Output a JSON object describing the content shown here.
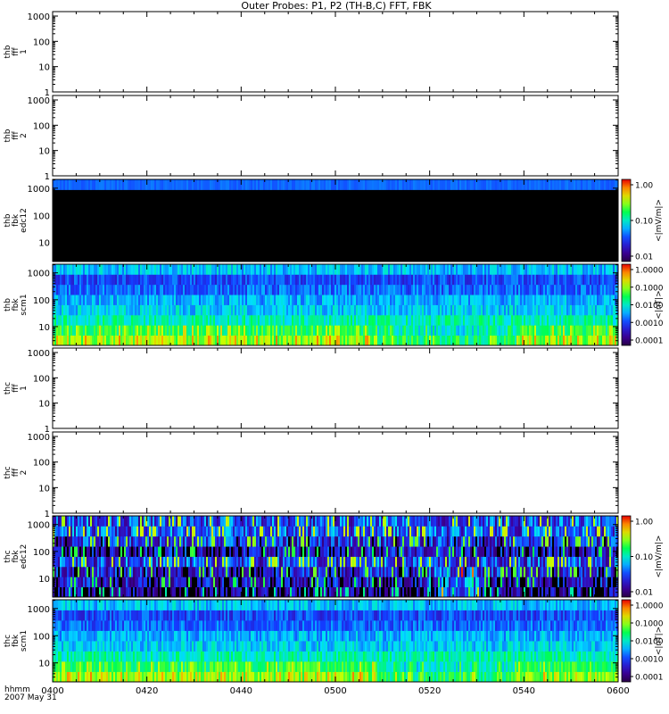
{
  "title": "Outer Probes: P1, P2 (TH-B,C) FFT, FBK",
  "chart_data": {
    "type": "heatmap",
    "title": "Outer Probes: P1, P2 (TH-B,C) FFT, FBK",
    "x_axis": {
      "ticks": [
        "0400",
        "0420",
        "0440",
        "0500",
        "0520",
        "0540",
        "0600"
      ],
      "label_line1": "hhmm",
      "label_line2": "2007 May 31"
    },
    "panels": [
      {
        "id": "thb-fff-1",
        "ylabel": [
          "thb",
          "fff",
          "1"
        ],
        "yticks": [
          "1000",
          "100",
          "10",
          "1"
        ],
        "has_data": false
      },
      {
        "id": "thb-fff-2",
        "ylabel": [
          "thb",
          "fff",
          "2"
        ],
        "yticks": [
          "1000",
          "100",
          "10",
          "1"
        ],
        "has_data": false
      },
      {
        "id": "thb-fbk-edc12",
        "ylabel": [
          "thb",
          "fbk",
          "edc12"
        ],
        "yticks": [
          "1000",
          "100",
          "10"
        ],
        "has_data": true,
        "pattern": "thb-edc",
        "colorbar": {
          "label": "<|mV/m|>",
          "ticks": [
            "1.00",
            "0.10",
            "0.01"
          ]
        }
      },
      {
        "id": "thb-fbk-scm1",
        "ylabel": [
          "thb",
          "fbk",
          "scm1"
        ],
        "yticks": [
          "1000",
          "100",
          "10"
        ],
        "has_data": true,
        "pattern": "scm",
        "colorbar": {
          "label": "<|nT|>",
          "ticks": [
            "1.0000",
            "0.1000",
            "0.0100",
            "0.0010",
            "0.0001"
          ]
        }
      },
      {
        "id": "thc-fff-1",
        "ylabel": [
          "thc",
          "fff",
          "1"
        ],
        "yticks": [
          "1000",
          "100",
          "10",
          "1"
        ],
        "has_data": false
      },
      {
        "id": "thc-fff-2",
        "ylabel": [
          "thc",
          "fff",
          "2"
        ],
        "yticks": [
          "1000",
          "100",
          "10",
          "1"
        ],
        "has_data": false
      },
      {
        "id": "thc-fbk-edc12",
        "ylabel": [
          "thc",
          "fbk",
          "edc12"
        ],
        "yticks": [
          "1000",
          "100",
          "10"
        ],
        "has_data": true,
        "pattern": "thc-edc",
        "colorbar": {
          "label": "<|mV/m|>",
          "ticks": [
            "1.00",
            "0.10",
            "0.01"
          ]
        }
      },
      {
        "id": "thc-fbk-scm1",
        "ylabel": [
          "thc",
          "fbk",
          "scm1"
        ],
        "yticks": [
          "1000",
          "100",
          "10"
        ],
        "has_data": true,
        "pattern": "scm",
        "colorbar": {
          "label": "<|nT|>",
          "ticks": [
            "1.0000",
            "0.1000",
            "0.0100",
            "0.0010",
            "0.0001"
          ]
        }
      }
    ]
  }
}
